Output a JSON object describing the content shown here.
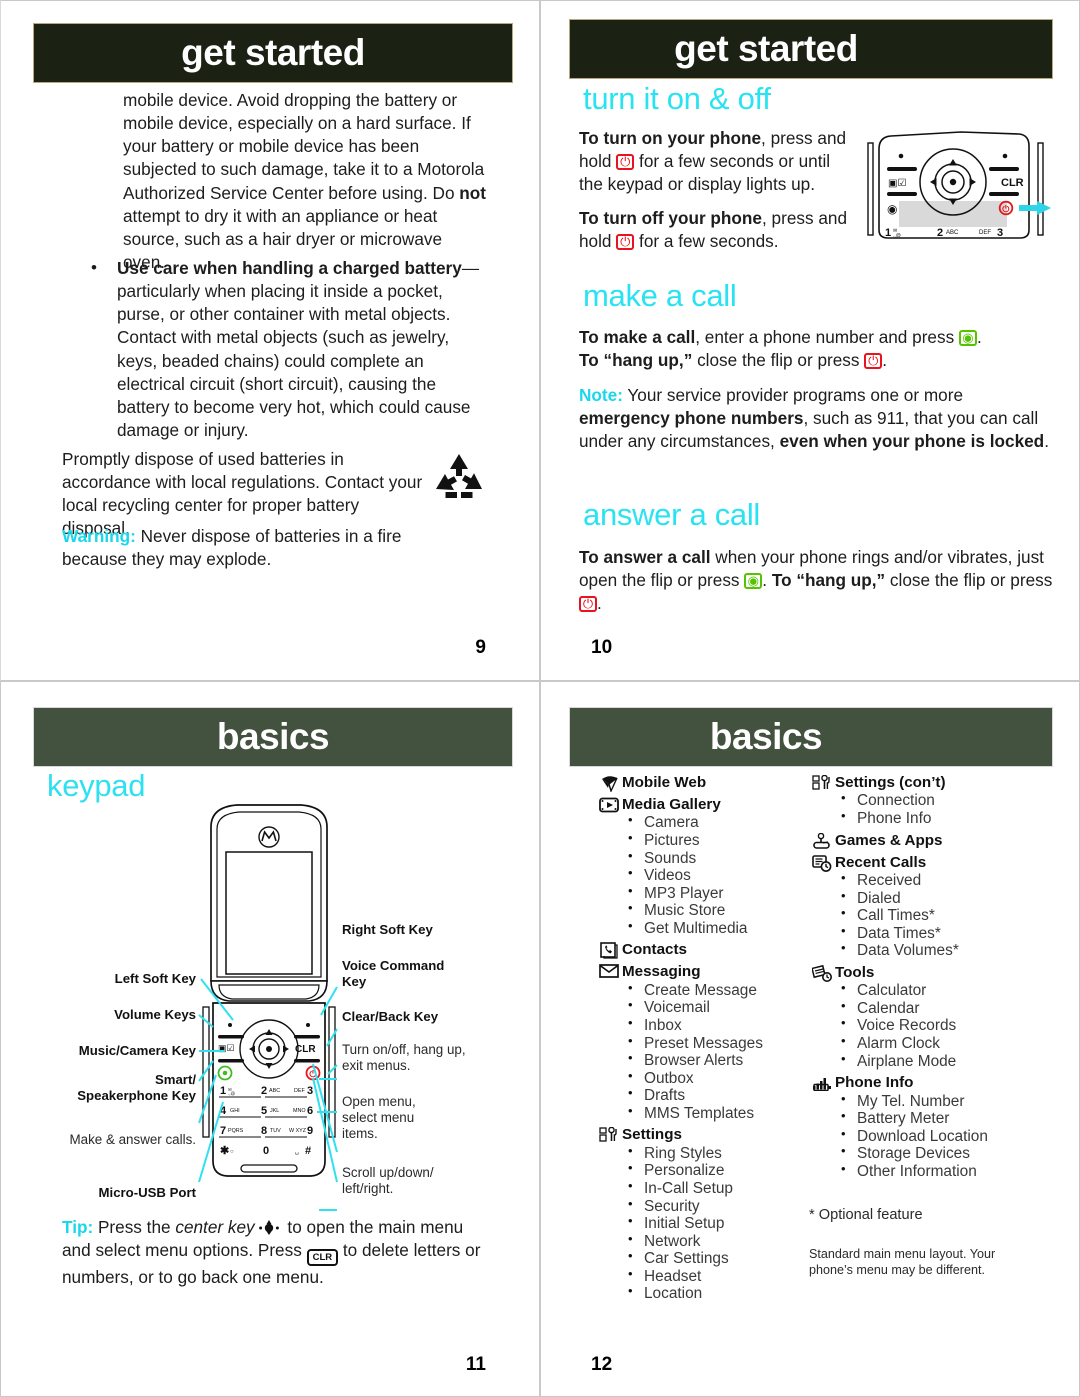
{
  "pages": {
    "p9": {
      "banner": "get started",
      "number": "9",
      "para1": "mobile device. Avoid dropping the battery or mobile device, especially on a hard surface. If your battery or mobile device has been subjected to such damage, take it to a Motorola Authorized Service Center before using. Do ",
      "para1_bold": "not",
      "para1_end": " attempt to dry it with an appliance or heat source, such as a hair dryer or microwave oven.",
      "bullet_bold": "Use care when handling a charged battery",
      "bullet_rest": "—particularly when placing it inside a pocket, purse, or other container with metal objects. Contact with metal objects (such as jewelry, keys, beaded chains) could complete an electrical circuit (short circuit), causing the battery to become very hot, which could cause damage or injury.",
      "para2": "Promptly dispose of used batteries in accordance with local regulations. Contact your local recycling center for proper battery disposal.",
      "warning_label": "Warning:",
      "warning_text": " Never dispose of batteries in a fire because they may explode."
    },
    "p10": {
      "banner": "get started",
      "number": "10",
      "sections": [
        {
          "title": "turn it on & off"
        },
        {
          "title": "make a call"
        },
        {
          "title": "answer a call"
        }
      ],
      "turn_on_bold": "To turn on your phone",
      "turn_on_a": ", press and hold ",
      "turn_on_b": " for a few seconds or until the keypad or display lights up.",
      "turn_off_bold": "To turn off your phone",
      "turn_off_a": ", press and hold ",
      "turn_off_b": " for a few seconds.",
      "make_bold": "To make a call",
      "make_a": ", enter a phone number and press ",
      "make_b": ".",
      "hangup_bold": "To “hang up,”",
      "hangup_a": " close the flip or press ",
      "hangup_b": ".",
      "note_label": "Note:",
      "note_a": " Your service provider programs one or more ",
      "note_bold1": "emergency phone numbers",
      "note_b": ", such as 911, that you can call under any circumstances, ",
      "note_bold2": "even when your phone is locked",
      "note_c": ".",
      "answer_bold": "To answer a call",
      "answer_a": " when your phone rings and/or vibrates, just open the flip or press ",
      "answer_b": ". ",
      "answer_bold2": "To “hang up,”",
      "answer_c": " close the flip or press ",
      "answer_d": "."
    },
    "p11": {
      "banner": "basics",
      "number": "11",
      "section": "keypad",
      "labels_left": [
        "Left Soft Key",
        "Volume Keys",
        "Music/Camera Key",
        "Smart/\nSpeakerphone Key"
      ],
      "label_left_plain": "Make & answer calls.",
      "label_left_last": "Micro-USB Port",
      "labels_right_bold": [
        "Right Soft Key",
        "Voice Command Key",
        "Clear/Back Key"
      ],
      "labels_right_plain": [
        "Turn  on/off, hang up, exit menus.",
        "Open menu, select menu items.",
        "Scroll up/down/ left/right."
      ],
      "tip_label": "Tip:",
      "tip_a": " Press the ",
      "tip_italic": "center key",
      "tip_b": " to open the main menu and select menu options. Press ",
      "tip_c": " to delete letters or numbers, or to go back one menu.",
      "keypad_keys": [
        "1",
        "2 ABC",
        "DEF 3",
        "4 GHI",
        "5 JKL",
        "MNO 6",
        "7 PQRS",
        "8 TUV",
        "W XYZ 9",
        "✱ ○",
        "0",
        "␣ #"
      ],
      "clr_label": "CLR"
    },
    "p12": {
      "banner": "basics",
      "number": "12",
      "left_column": [
        {
          "icon": "mobile-web-icon",
          "name": "Mobile Web",
          "sub": []
        },
        {
          "icon": "media-gallery-icon",
          "name": "Media Gallery",
          "sub": [
            "Camera",
            "Pictures",
            "Sounds",
            "Videos",
            "MP3 Player",
            "Music Store",
            "Get Multimedia"
          ]
        },
        {
          "icon": "contacts-icon",
          "name": "Contacts",
          "sub": []
        },
        {
          "icon": "messaging-icon",
          "name": "Messaging",
          "sub": [
            "Create Message",
            "Voicemail",
            "Inbox",
            "Preset Messages",
            "Browser Alerts",
            "Outbox",
            "Drafts",
            "MMS Templates"
          ]
        },
        {
          "icon": "settings-icon",
          "name": "Settings",
          "sub": [
            "Ring Styles",
            "Personalize",
            "In-Call Setup",
            "Security",
            "Initial Setup",
            "Network",
            "Car Settings",
            "Headset",
            "Location"
          ]
        }
      ],
      "right_column": [
        {
          "icon": "settings-icon",
          "name": "Settings (con’t)",
          "sub": [
            "Connection",
            "Phone Info"
          ]
        },
        {
          "icon": "games-apps-icon",
          "name": "Games & Apps",
          "sub": []
        },
        {
          "icon": "recent-calls-icon",
          "name": "Recent Calls",
          "sub": [
            "Received",
            "Dialed",
            "Call Times*",
            "Data Times*",
            "Data Volumes*"
          ]
        },
        {
          "icon": "tools-icon",
          "name": "Tools",
          "sub": [
            "Calculator",
            "Calendar",
            "Voice Records",
            "Alarm Clock",
            "Airplane Mode"
          ]
        },
        {
          "icon": "phone-info-icon",
          "name": "Phone Info",
          "sub": [
            "My Tel. Number",
            "Battery Meter",
            "Download Location",
            "Storage Devices",
            "Other Information"
          ]
        }
      ],
      "footnote": "* Optional feature",
      "disclaimer": "Standard main menu layout. Your phone’s menu may be different."
    }
  },
  "colors": {
    "banner_dark": "#1b2214",
    "banner_mid": "#43513f",
    "accent_cyan": "#29e3f2",
    "key_red": "#e8141d",
    "key_green": "#55c400"
  }
}
